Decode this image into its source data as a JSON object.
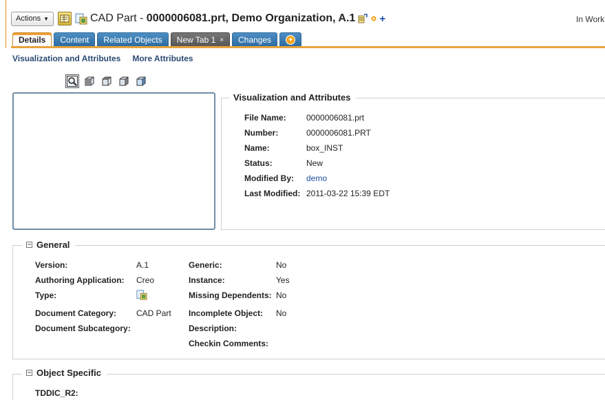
{
  "header": {
    "actions_label": "Actions",
    "title_prefix": "CAD Part - ",
    "title_bold": "0000006081.prt, Demo Organization, A.1",
    "plus": "+",
    "status_text": "In Work"
  },
  "tabs": [
    {
      "label": "Details",
      "active": true
    },
    {
      "label": "Content"
    },
    {
      "label": "Related Objects"
    },
    {
      "label": "New Tab 1",
      "close": "×"
    },
    {
      "label": "Changes"
    }
  ],
  "subnav": {
    "visualization": "Visualization and Attributes",
    "more": "More Attributes"
  },
  "vis": {
    "legend": "Visualization and Attributes",
    "rows": [
      {
        "label": "File Name:",
        "value": "0000006081.prt"
      },
      {
        "label": "Number:",
        "value": "0000006081.PRT"
      },
      {
        "label": "Name:",
        "value": "box_INST"
      },
      {
        "label": "Status:",
        "value": "New"
      },
      {
        "label": "Modified By:",
        "value": "demo"
      },
      {
        "label": "Last Modified:",
        "value": "2011-03-22 15:39 EDT"
      }
    ]
  },
  "general": {
    "legend": "General",
    "left": [
      {
        "label": "Version:",
        "value": "A.1"
      },
      {
        "label": "Authoring Application:",
        "value": "Creo"
      },
      {
        "label": "Type:",
        "value": ""
      },
      {
        "label": "Document Category:",
        "value": "CAD Part"
      },
      {
        "label": "Document Subcategory:",
        "value": ""
      }
    ],
    "right": [
      {
        "label": "Generic:",
        "value": "No"
      },
      {
        "label": "Instance:",
        "value": "Yes"
      },
      {
        "label": "Missing Dependents:",
        "value": "No"
      },
      {
        "label": "Incomplete Object:",
        "value": "No"
      },
      {
        "label": "Description:",
        "value": ""
      },
      {
        "label": "Checkin Comments:",
        "value": ""
      }
    ]
  },
  "object_specific": {
    "legend": "Object Specific",
    "rows": [
      {
        "label": "TDDIC_R2:",
        "value": ""
      }
    ]
  },
  "colors": {
    "tab_blue": "#2c6aa0",
    "tab_active_accent": "#f0a030",
    "link": "#1d4e9b"
  }
}
